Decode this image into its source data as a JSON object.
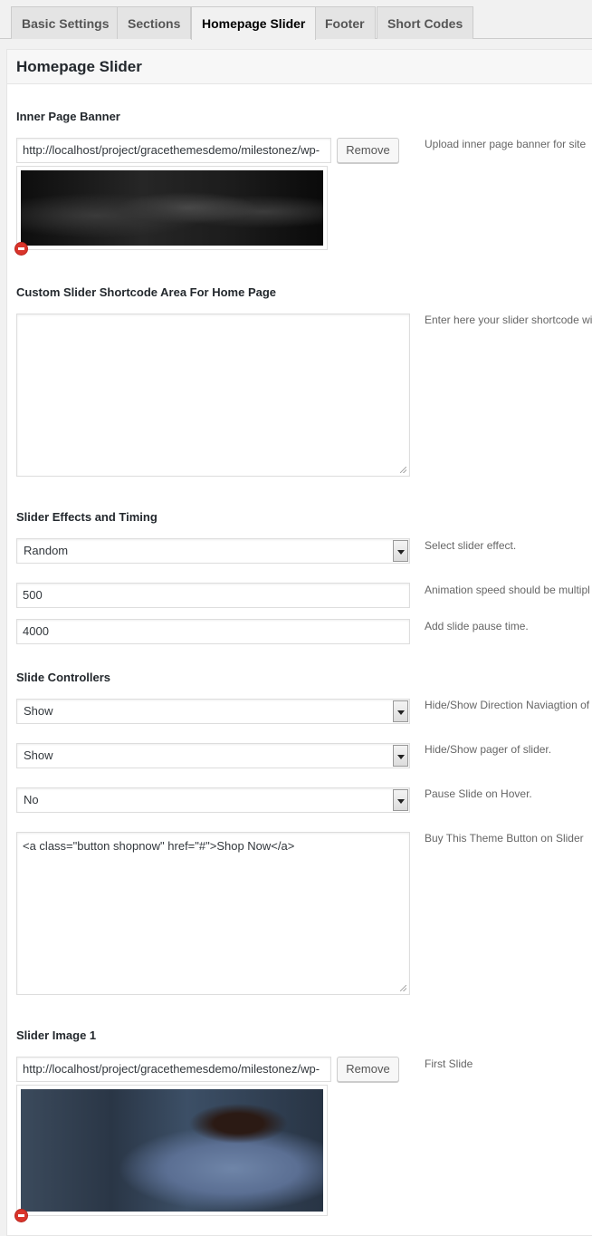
{
  "tabs": [
    {
      "label": "Basic Settings",
      "active": false
    },
    {
      "label": "Sections",
      "active": false
    },
    {
      "label": "Homepage Slider",
      "active": true
    },
    {
      "label": "Footer",
      "active": false
    },
    {
      "label": "Short Codes",
      "active": false
    }
  ],
  "panel": {
    "title": "Homepage Slider"
  },
  "inner_banner": {
    "label": "Inner Page Banner",
    "url_value": "http://localhost/project/gracethemesdemo/milestonez/wp-",
    "remove_label": "Remove",
    "description": "Upload inner page banner for site"
  },
  "custom_slider": {
    "label": "Custom Slider Shortcode Area For Home Page",
    "value": "",
    "description": "Enter here your slider shortcode wit"
  },
  "effects": {
    "label": "Slider Effects and Timing",
    "effect_value": "Random",
    "effect_description": "Select slider effect.",
    "speed_value": "500",
    "speed_description": "Animation speed should be multipl",
    "pause_value": "4000",
    "pause_description": "Add slide pause time."
  },
  "controllers": {
    "label": "Slide Controllers",
    "direction_value": "Show",
    "direction_description": "Hide/Show Direction Naviagtion of",
    "pager_value": "Show",
    "pager_description": "Hide/Show pager of slider.",
    "hover_value": "No",
    "hover_description": "Pause Slide on Hover.",
    "button_code": "<a class=\"button shopnow\" href=\"#\">Shop Now</a>",
    "button_description": "Buy This Theme Button on Slider"
  },
  "slider_image_1": {
    "label": "Slider Image 1",
    "url_value": "http://localhost/project/gracethemesdemo/milestonez/wp-",
    "remove_label": "Remove",
    "description": "First Slide"
  },
  "colors": {
    "remove_dot": "#d9342b",
    "panel_bg": "#ffffff",
    "page_bg": "#f1f1f1"
  }
}
